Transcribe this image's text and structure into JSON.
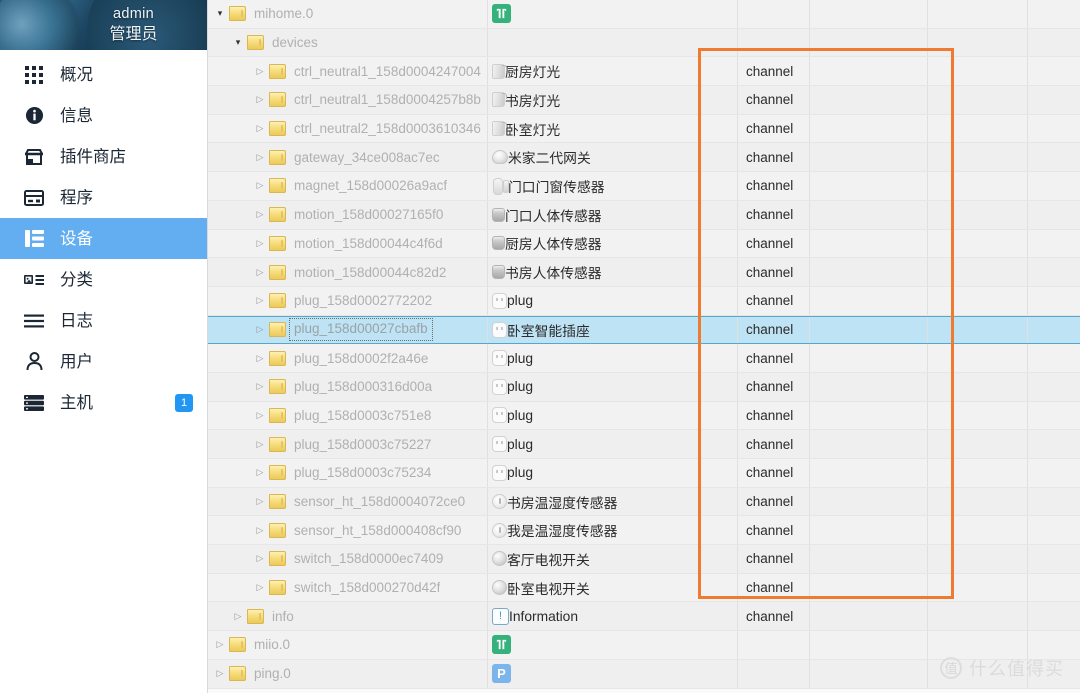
{
  "sidebar": {
    "profile": {
      "user": "admin",
      "role": "管理员"
    },
    "items": [
      {
        "label": "概况",
        "icon": "grid-icon",
        "active": false,
        "badge": ""
      },
      {
        "label": "信息",
        "icon": "info-icon",
        "active": false,
        "badge": ""
      },
      {
        "label": "插件商店",
        "icon": "store-icon",
        "active": false,
        "badge": ""
      },
      {
        "label": "程序",
        "icon": "program-icon",
        "active": false,
        "badge": ""
      },
      {
        "label": "设备",
        "icon": "devices-list-icon",
        "active": true,
        "badge": ""
      },
      {
        "label": "分类",
        "icon": "category-icon",
        "active": false,
        "badge": ""
      },
      {
        "label": "日志",
        "icon": "log-lines-icon",
        "active": false,
        "badge": ""
      },
      {
        "label": "用户",
        "icon": "user-icon",
        "active": false,
        "badge": ""
      },
      {
        "label": "主机",
        "icon": "host-server-icon",
        "active": false,
        "badge": "1"
      }
    ]
  },
  "table": {
    "type_label": "channel",
    "rows": [
      {
        "indent": 1,
        "twisty": "open",
        "name": "mihome.0",
        "title": "",
        "icon": "mihome-badge-icon",
        "type": "",
        "selected": false
      },
      {
        "indent": 2,
        "twisty": "open",
        "name": "devices",
        "title": "",
        "icon": "",
        "type": "",
        "selected": false
      },
      {
        "indent": 3,
        "twisty": "closed",
        "name": "ctrl_neutral1_158d0004247004",
        "title": "厨房灯光",
        "icon": "ctrl-switch-icon",
        "type": "channel",
        "selected": false
      },
      {
        "indent": 3,
        "twisty": "closed",
        "name": "ctrl_neutral1_158d0004257b8b",
        "title": "书房灯光",
        "icon": "ctrl-switch-icon",
        "type": "channel",
        "selected": false
      },
      {
        "indent": 3,
        "twisty": "closed",
        "name": "ctrl_neutral2_158d0003610346",
        "title": "卧室灯光",
        "icon": "ctrl-switch-icon",
        "type": "channel",
        "selected": false
      },
      {
        "indent": 3,
        "twisty": "closed",
        "name": "gateway_34ce008ac7ec",
        "title": "米家二代网关",
        "icon": "gateway-icon",
        "type": "channel",
        "selected": false
      },
      {
        "indent": 3,
        "twisty": "closed",
        "name": "magnet_158d00026a9acf",
        "title": "门口门窗传感器",
        "icon": "magnet-sensor-icon",
        "type": "channel",
        "selected": false
      },
      {
        "indent": 3,
        "twisty": "closed",
        "name": "motion_158d00027165f0",
        "title": "门口人体传感器",
        "icon": "motion-sensor-icon",
        "type": "channel",
        "selected": false
      },
      {
        "indent": 3,
        "twisty": "closed",
        "name": "motion_158d00044c4f6d",
        "title": "厨房人体传感器",
        "icon": "motion-sensor-icon",
        "type": "channel",
        "selected": false
      },
      {
        "indent": 3,
        "twisty": "closed",
        "name": "motion_158d00044c82d2",
        "title": "书房人体传感器",
        "icon": "motion-sensor-icon",
        "type": "channel",
        "selected": false
      },
      {
        "indent": 3,
        "twisty": "closed",
        "name": "plug_158d0002772202",
        "title": "plug",
        "icon": "plug-icon",
        "type": "channel",
        "selected": false
      },
      {
        "indent": 3,
        "twisty": "closed",
        "name": "plug_158d00027cbafb",
        "title": "卧室智能插座",
        "icon": "plug-icon",
        "type": "channel",
        "selected": true
      },
      {
        "indent": 3,
        "twisty": "closed",
        "name": "plug_158d0002f2a46e",
        "title": "plug",
        "icon": "plug-icon",
        "type": "channel",
        "selected": false
      },
      {
        "indent": 3,
        "twisty": "closed",
        "name": "plug_158d000316d00a",
        "title": "plug",
        "icon": "plug-icon",
        "type": "channel",
        "selected": false
      },
      {
        "indent": 3,
        "twisty": "closed",
        "name": "plug_158d0003c751e8",
        "title": "plug",
        "icon": "plug-icon",
        "type": "channel",
        "selected": false
      },
      {
        "indent": 3,
        "twisty": "closed",
        "name": "plug_158d0003c75227",
        "title": "plug",
        "icon": "plug-icon",
        "type": "channel",
        "selected": false
      },
      {
        "indent": 3,
        "twisty": "closed",
        "name": "plug_158d0003c75234",
        "title": "plug",
        "icon": "plug-icon",
        "type": "channel",
        "selected": false
      },
      {
        "indent": 3,
        "twisty": "closed",
        "name": "sensor_ht_158d0004072ce0",
        "title": "书房温湿度传感器",
        "icon": "ht-sensor-icon",
        "type": "channel",
        "selected": false
      },
      {
        "indent": 3,
        "twisty": "closed",
        "name": "sensor_ht_158d000408cf90",
        "title": "我是温湿度传感器",
        "icon": "ht-sensor-icon",
        "type": "channel",
        "selected": false
      },
      {
        "indent": 3,
        "twisty": "closed",
        "name": "switch_158d0000ec7409",
        "title": "客厅电视开关",
        "icon": "round-switch-icon",
        "type": "channel",
        "selected": false
      },
      {
        "indent": 3,
        "twisty": "closed",
        "name": "switch_158d000270d42f",
        "title": "卧室电视开关",
        "icon": "round-switch-icon",
        "type": "channel",
        "selected": false
      },
      {
        "indent": 2,
        "twisty": "closed",
        "name": "info",
        "title": "Information",
        "icon": "information-badge-icon",
        "type": "channel",
        "selected": false
      },
      {
        "indent": 1,
        "twisty": "closed",
        "name": "miio.0",
        "title": "",
        "icon": "mihome-badge-icon",
        "type": "",
        "selected": false
      },
      {
        "indent": 1,
        "twisty": "closed",
        "name": "ping.0",
        "title": "",
        "icon": "ping-badge-icon",
        "type": "",
        "selected": false
      }
    ]
  },
  "highlight": {
    "color": "#ee7b2f",
    "name": "orange-selection-rectangle"
  },
  "watermark": {
    "mark": "值",
    "text": "什么值得买"
  },
  "colors": {
    "accent": "#62aef0",
    "selected_row": "#bee3f5",
    "badge": "#2196f3",
    "highlight": "#ee7b2f"
  }
}
